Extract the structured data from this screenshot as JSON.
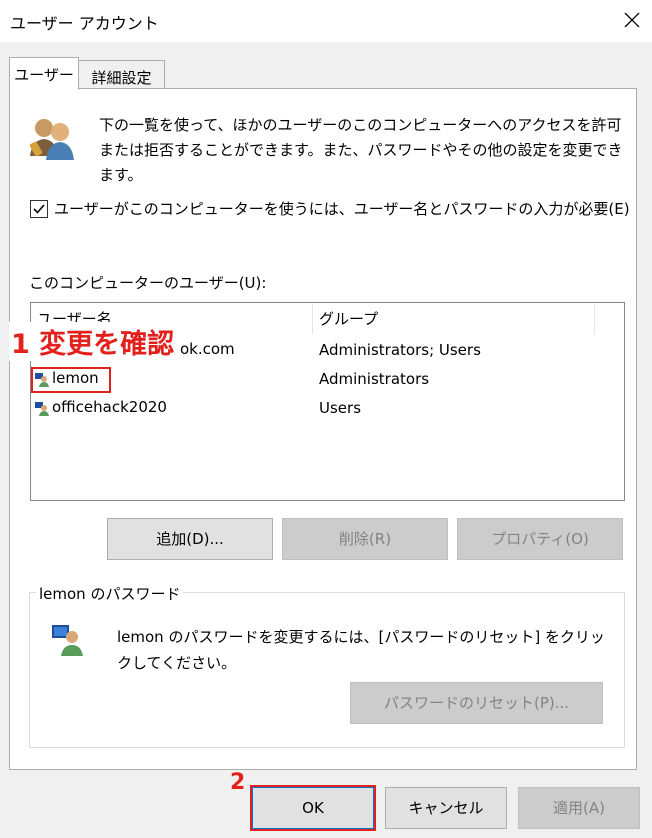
{
  "window": {
    "title": "ユーザー アカウント"
  },
  "tabs": [
    {
      "label": "ユーザー"
    },
    {
      "label": "詳細設定"
    }
  ],
  "description": "下の一覧を使って、ほかのユーザーのこのコンピューターへのアクセスを許可または拒否することができます。また、パスワードやその他の設定を変更できます。",
  "require_password": {
    "label": "ユーザーがこのコンピューターを使うには、ユーザー名とパスワードの入力が必要(E)",
    "checked": true
  },
  "users_list": {
    "label": "このコンピューターのユーザー(U):",
    "columns": [
      "ユーザー名",
      "グループ"
    ],
    "rows": [
      {
        "name": "ok.com",
        "group": "Administrators; Users"
      },
      {
        "name": "lemon",
        "group": "Administrators"
      },
      {
        "name": "officehack2020",
        "group": "Users"
      }
    ]
  },
  "buttons": {
    "add": "追加(D)...",
    "remove": "削除(R)",
    "properties": "プロパティ(O)",
    "reset_password": "パスワードのリセット(P)...",
    "ok": "OK",
    "cancel": "キャンセル",
    "apply": "適用(A)"
  },
  "password_group": {
    "title": "lemon のパスワード",
    "description": "lemon のパスワードを変更するには、[パスワードのリセット] をクリックしてください。"
  },
  "annotations": {
    "step1": "1 変更を確認",
    "step2": "2"
  },
  "colors": {
    "annotation": "#e3211c",
    "accent": "#0078d7"
  },
  "icons": {
    "users": "users-icon",
    "user": "user-icon",
    "close": "close-icon",
    "check": "check-icon"
  }
}
